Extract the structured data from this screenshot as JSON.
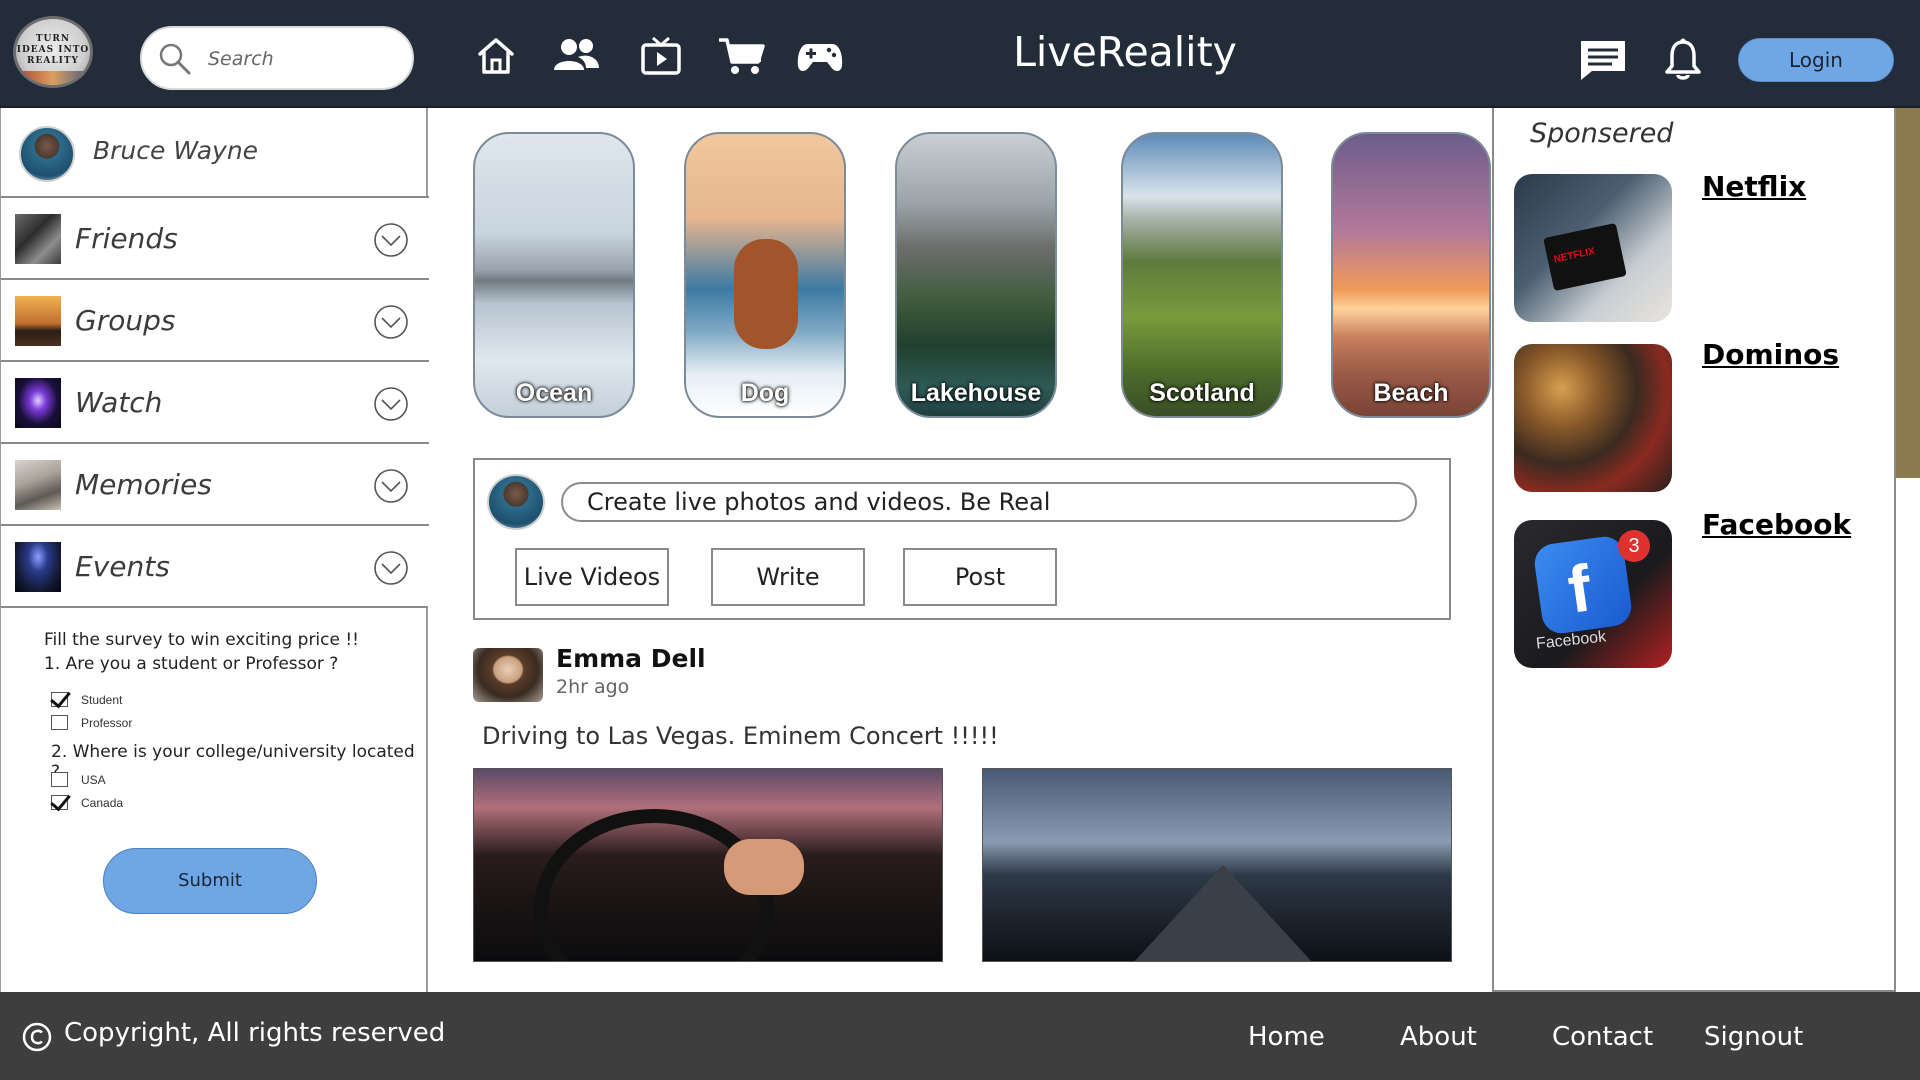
{
  "header": {
    "logo_text": [
      "TURN",
      "IDEAS INTO",
      "REALITY"
    ],
    "search_placeholder": "Search",
    "brand": "LiveReality",
    "login_label": "Login",
    "nav_icons": [
      "home-icon",
      "friends-icon",
      "watch-tv-icon",
      "cart-icon",
      "gamepad-icon"
    ],
    "right_icons": [
      "messages-icon",
      "notification-bell-icon"
    ]
  },
  "profile": {
    "name": "Bruce Wayne"
  },
  "menu": [
    {
      "label": "Friends"
    },
    {
      "label": "Groups"
    },
    {
      "label": "Watch"
    },
    {
      "label": "Memories"
    },
    {
      "label": "Events"
    }
  ],
  "survey": {
    "intro": "Fill the survey to win exciting price !!",
    "q1": "1. Are you a student or Professor ?",
    "q1_options": [
      {
        "label": "Student",
        "checked": true
      },
      {
        "label": "Professor",
        "checked": false
      }
    ],
    "q2": "2. Where is your college/university located ?",
    "q2_options": [
      {
        "label": "USA",
        "checked": false
      },
      {
        "label": "Canada",
        "checked": true
      }
    ],
    "submit_label": "Submit"
  },
  "stories": [
    {
      "label": "Ocean"
    },
    {
      "label": "Dog"
    },
    {
      "label": "Lakehouse"
    },
    {
      "label": "Scotland"
    },
    {
      "label": "Beach"
    }
  ],
  "composer": {
    "prompt": "Create live photos and videos. Be Real",
    "buttons": [
      "Live Videos",
      "Write",
      "Post"
    ]
  },
  "post": {
    "author": "Emma Dell",
    "time": "2hr ago",
    "text": "Driving to Las Vegas. Eminem Concert !!!!!"
  },
  "sponsored": {
    "title": "Sponsered",
    "ads": [
      {
        "name": "Netflix",
        "badge_text": "NETFLIX"
      },
      {
        "name": "Dominos"
      },
      {
        "name": "Facebook",
        "app_label": "Facebook",
        "badge_count": "3"
      }
    ]
  },
  "footer": {
    "copyright": "Copyright, All rights reserved",
    "links": [
      "Home",
      "About",
      "Contact",
      "Signout"
    ]
  },
  "colors": {
    "header_bg": "#232d3a",
    "footer_bg": "#3e3e3e",
    "accent_button": "#6ea6e6"
  }
}
